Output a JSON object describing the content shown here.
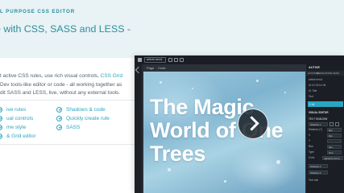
{
  "hero": {
    "eyebrow": "L PURPOSE CSS EDITOR",
    "headline_line1": "e with CSS, SASS and LESS -",
    "headline_line2": "!"
  },
  "description": {
    "line1_prefix": "t active CSS rules, use rich visual controls, ",
    "line1_link": "CSS Grid",
    "line2": " Dev tools-like editor or code - all working together as",
    "line3": "dit SASS and LESS, live, without any external tools."
  },
  "features": [
    {
      "label": "ive rules",
      "icon": "check-circle-icon"
    },
    {
      "label": "Shadows & code",
      "icon": "check-circle-icon"
    },
    {
      "label": "ual controls",
      "icon": "check-circle-icon"
    },
    {
      "label": "Quickly create rule",
      "icon": "check-circle-icon"
    },
    {
      "label": "me style",
      "icon": "check-circle-icon"
    },
    {
      "label": "SASS",
      "icon": "check-circle-icon"
    },
    {
      "label": "& Grid editor",
      "icon": "check-circle-icon"
    }
  ],
  "editor": {
    "selector_value": "article.hero1",
    "breadcrumb": [
      "Page",
      "Code"
    ],
    "canvas_text_line1": "The Magic",
    "canvas_text_line2": "World of One",
    "canvas_text_line3": "Trees",
    "panel": {
      "title": "ACTIVE",
      "tabs": [
        "CUSTOM",
        "MEDIA",
        "STATE",
        "SASS"
      ],
      "rows": [
        "article.hero1",
        "h1 h2 h3 h4 h5",
        "h1 Title",
        "Text"
      ],
      "highlight": "1 h1",
      "section": "VISUAL EDITOR",
      "group": "TEXT SHADOW",
      "shadow_label": "Shadow 1",
      "distance_label": "Distance (?)",
      "distance_value": "6px",
      "x_label": "X",
      "x_value": "6px",
      "y_label": "Y",
      "blur_label": "Blur",
      "blur_value": "0px",
      "type_label": "Type",
      "type_value": "Text",
      "color_label": "Color",
      "color_value": "rgba(0,0,0,0.2)",
      "shadow2": "Shadow 2",
      "shadow3": "Shadow 3",
      "footer": "Text rule"
    }
  },
  "colors": {
    "accent": "#2aa6c2",
    "hero_bg": "#e9f2f4",
    "editor_bg": "#1b1f25"
  }
}
